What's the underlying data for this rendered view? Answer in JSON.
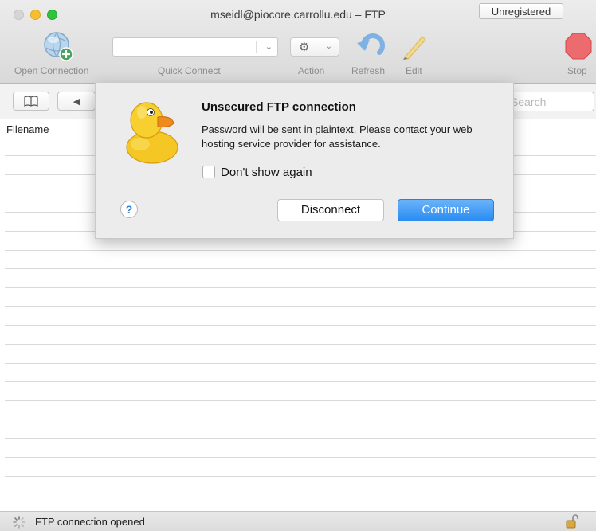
{
  "window": {
    "title": "mseidl@piocore.carrollu.edu – FTP",
    "unregistered_label": "Unregistered"
  },
  "toolbar": {
    "open_connection_label": "Open Connection",
    "quick_connect_label": "Quick Connect",
    "quick_connect_value": "",
    "action_label": "Action",
    "refresh_label": "Refresh",
    "edit_label": "Edit",
    "stop_label": "Stop",
    "icons": {
      "open_connection": "globe-plus-icon",
      "action": "gear-icon",
      "refresh": "refresh-icon",
      "edit": "pencil-icon",
      "stop": "stop-icon"
    }
  },
  "navbar": {
    "bookmarks_icon": "book-icon",
    "back_icon": "back-arrow-icon",
    "search_placeholder": "Search"
  },
  "filelist": {
    "column_header": "Filename",
    "rows": []
  },
  "dialog": {
    "title": "Unsecured FTP connection",
    "message": "Password will be sent in plaintext. Please contact your web hosting service provider for assistance.",
    "checkbox_label": "Don't show again",
    "checkbox_checked": false,
    "help_label": "?",
    "disconnect_label": "Disconnect",
    "continue_label": "Continue",
    "icon": "duck-icon"
  },
  "status": {
    "text": "FTP connection opened",
    "lock_icon": "unlocked-padlock-icon"
  },
  "colors": {
    "accent_blue": "#2a8cf1",
    "stop_red": "#e8484a",
    "close_gray": "#d5d5d5",
    "minimize_yellow": "#f7be2f",
    "maximize_green": "#2fc43f"
  }
}
